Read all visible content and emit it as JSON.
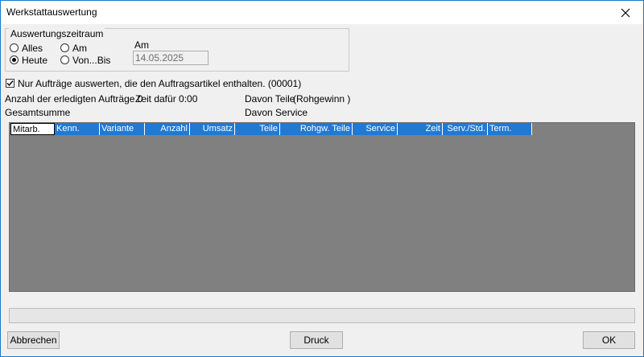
{
  "window": {
    "title": "Werkstattauswertung"
  },
  "period": {
    "legend": "Auswertungszeitraum",
    "options": {
      "all": "Alles",
      "today": "Heute",
      "on": "Am",
      "range": "Von...Bis"
    },
    "date_label": "Am",
    "date_value": "14.05.2025",
    "selected": "Heute"
  },
  "filter": {
    "checked": true,
    "label": "Nur Aufträge auswerten, die den Auftragsartikel enthalten. (00001)"
  },
  "stats": {
    "orders_done": "Anzahl der erledigten Aufträge 0",
    "time": "Zeit dafür 0:00",
    "parts": "Davon Teile",
    "gross_profit": "(Rohgewinn )",
    "total": "Gesamtsumme",
    "service": "Davon Service"
  },
  "table": {
    "columns": [
      "Mitarb.",
      "Kenn.",
      "Variante",
      "Anzahl",
      "Umsatz",
      "Teile",
      "Rohgw. Teile",
      "Service",
      "Zeit",
      "Serv./Std.",
      "Term."
    ]
  },
  "buttons": {
    "cancel": "Abbrechen",
    "print": "Druck",
    "ok": "OK"
  }
}
